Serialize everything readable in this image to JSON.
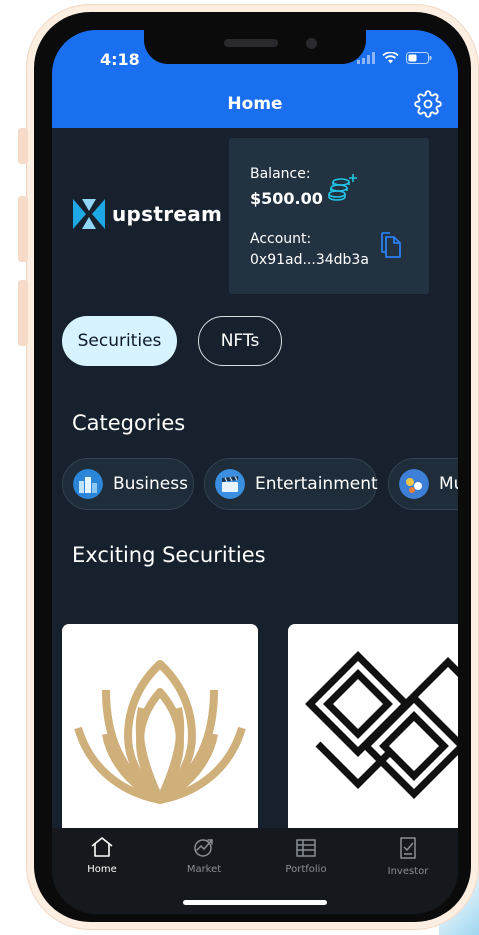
{
  "status_bar": {
    "time": "4:18"
  },
  "header": {
    "title": "Home",
    "settings_icon": "gear-icon"
  },
  "brand": {
    "name": "upstream"
  },
  "wallet": {
    "balance_label": "Balance:",
    "balance_value": "$500.00",
    "account_label": "Account:",
    "account_value": "0x91ad...34db3a"
  },
  "segments": [
    {
      "label": "Securities",
      "active": true
    },
    {
      "label": "NFTs",
      "active": false
    }
  ],
  "categories": {
    "title": "Categories",
    "items": [
      {
        "label": "Business",
        "icon": "business-icon"
      },
      {
        "label": "Entertainment",
        "icon": "entertainment-icon"
      },
      {
        "label": "Mu",
        "icon": "music-icon"
      }
    ]
  },
  "exciting": {
    "title": "Exciting Securities"
  },
  "tabs": [
    {
      "label": "Home",
      "icon": "home-icon",
      "active": true
    },
    {
      "label": "Market",
      "icon": "market-icon",
      "active": false
    },
    {
      "label": "Portfolio",
      "icon": "portfolio-icon",
      "active": false
    },
    {
      "label": "Investor",
      "icon": "investor-icon",
      "active": false
    }
  ],
  "colors": {
    "header": "#1a6ff0",
    "background": "#16212d",
    "accent": "#1fa8e6",
    "pill_active": "#d6f3ff"
  }
}
